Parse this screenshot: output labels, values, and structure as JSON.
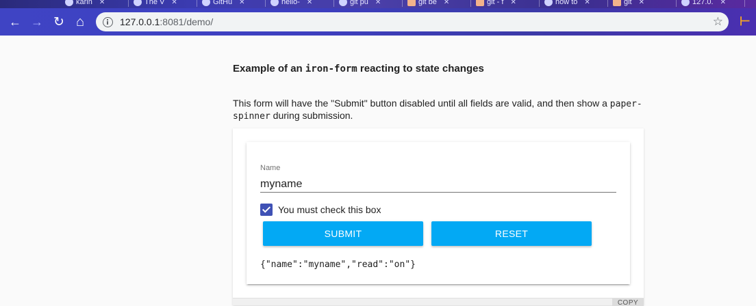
{
  "browser": {
    "tabs": [
      {
        "label": "karin",
        "fav": "github-icon"
      },
      {
        "label": "The V",
        "fav": "page-icon"
      },
      {
        "label": "GitHu",
        "fav": "github-icon"
      },
      {
        "label": "hello-",
        "fav": "github-icon"
      },
      {
        "label": "git pu",
        "fav": "google-icon"
      },
      {
        "label": "git be",
        "fav": "doc-icon"
      },
      {
        "label": "git - f",
        "fav": "doc-icon"
      },
      {
        "label": "how to",
        "fav": "google-icon"
      },
      {
        "label": "git",
        "fav": "doc-icon"
      },
      {
        "label": "127.0.",
        "fav": "page-icon"
      }
    ],
    "url_host": "127.0.0.1",
    "url_rest": ":8081/demo/",
    "tab_close": "✕",
    "back": "←",
    "forward": "→",
    "reload": "↻",
    "home": "⌂",
    "star": "☆",
    "extension": "⊢"
  },
  "page": {
    "heading_pre": "Example of an ",
    "heading_code": "iron-form",
    "heading_post": " reacting to state changes",
    "desc_pre": "This form will have the \"Submit\" button disabled until all fields are valid, and then show a ",
    "desc_code": "paper-spinner",
    "desc_post": " during submission."
  },
  "form": {
    "name_label": "Name",
    "name_value": "myname",
    "checkbox_label": "You must check this box",
    "checkbox_checked": true,
    "submit_label": "SUBMIT",
    "reset_label": "RESET",
    "output": "{\"name\":\"myname\",\"read\":\"on\"}"
  },
  "code": {
    "copy_label": "COPY"
  },
  "colors": {
    "primary": "#3f51b5",
    "button": "#03a9f4"
  }
}
